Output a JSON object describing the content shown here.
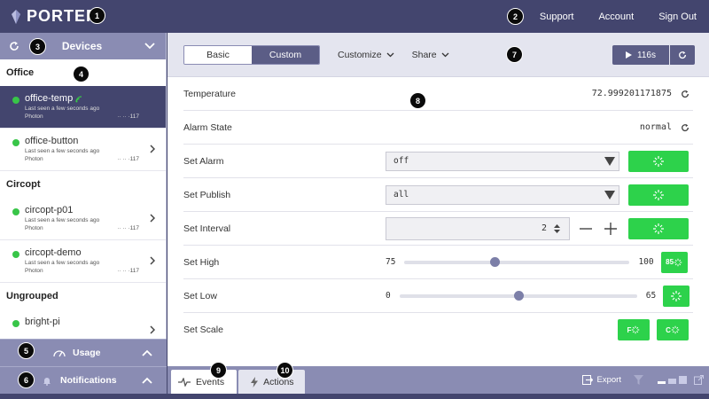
{
  "app": {
    "name": "PORTER"
  },
  "nav": {
    "support": "Support",
    "account": "Account",
    "signout": "Sign Out"
  },
  "sidebar": {
    "title": "Devices",
    "groups": [
      {
        "label": "Office",
        "devices": [
          {
            "name": "office-temp",
            "seen": "Last seen a few seconds ago",
            "type": "Photon",
            "ip": "·· ·· ·117"
          },
          {
            "name": "office-button",
            "seen": "Last seen a few seconds ago",
            "type": "Photon",
            "ip": "·· ·· ·117"
          }
        ]
      },
      {
        "label": "Circopt",
        "devices": [
          {
            "name": "circopt-p01",
            "seen": "Last seen a few seconds ago",
            "type": "Photon",
            "ip": "·· ·· ·117"
          },
          {
            "name": "circopt-demo",
            "seen": "Last seen a few seconds ago",
            "type": "Photon",
            "ip": "·· ·· ·117"
          }
        ]
      },
      {
        "label": "Ungrouped",
        "devices": [
          {
            "name": "bright-pi"
          }
        ]
      }
    ],
    "usage": "Usage",
    "notifications": "Notifications"
  },
  "toolbar": {
    "basic": "Basic",
    "custom": "Custom",
    "customize": "Customize",
    "share": "Share",
    "timer": "116s"
  },
  "rows": {
    "temperature": {
      "label": "Temperature",
      "value": "72.999201171875"
    },
    "alarm_state": {
      "label": "Alarm State",
      "value": "normal"
    },
    "set_alarm": {
      "label": "Set Alarm",
      "value": "off"
    },
    "set_publish": {
      "label": "Set Publish",
      "value": "all"
    },
    "set_interval": {
      "label": "Set Interval",
      "value": "2"
    },
    "set_high": {
      "label": "Set High",
      "min": "75",
      "max": "100",
      "button": "85",
      "fraction": 0.4
    },
    "set_low": {
      "label": "Set Low",
      "min": "0",
      "max": "65",
      "fraction": 0.5
    },
    "set_scale": {
      "label": "Set Scale",
      "f": "F",
      "c": "C"
    }
  },
  "bottom_tabs": {
    "events": "Events",
    "actions": "Actions",
    "export": "Export"
  },
  "badges": [
    "1",
    "2",
    "3",
    "4",
    "5",
    "6",
    "7",
    "8",
    "9",
    "10"
  ],
  "colors": {
    "accent": "#43456e",
    "green": "#2dd24b",
    "status_online": "#38c548"
  }
}
